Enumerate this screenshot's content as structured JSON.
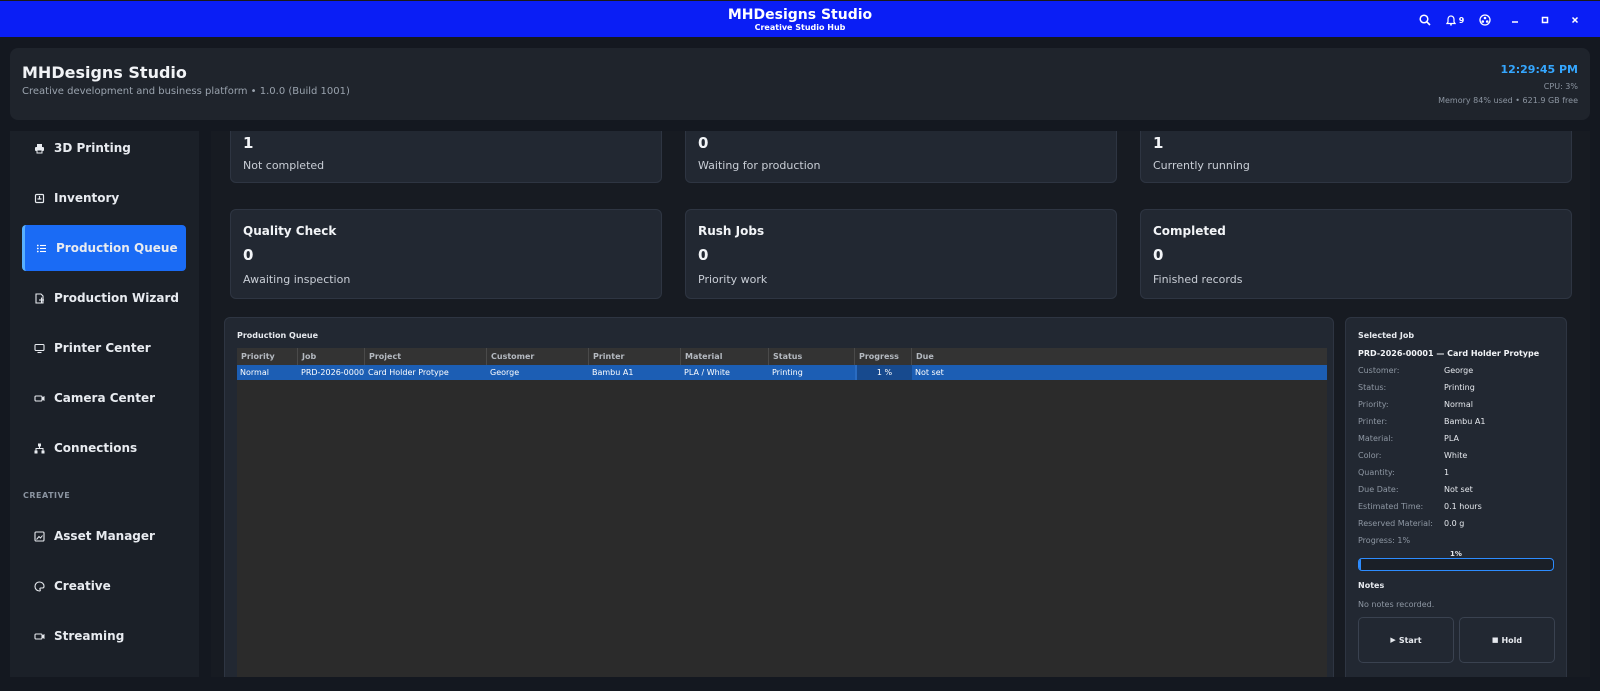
{
  "window": {
    "title": "MHDesigns Studio",
    "subtitle": "Creative Studio Hub",
    "notification_count": "9"
  },
  "header": {
    "title": "MHDesigns Studio",
    "subtitle": "Creative development and business platform • 1.0.0 (Build 1001)",
    "time": "12:29:45 PM",
    "cpu": "CPU: 3%",
    "memory": "Memory 84% used • 621.9 GB free"
  },
  "sidebar": {
    "items": [
      {
        "label": "3D Printing",
        "icon": "printer-icon"
      },
      {
        "label": "Inventory",
        "icon": "box-icon"
      },
      {
        "label": "Production Queue",
        "icon": "list-icon",
        "active": true
      },
      {
        "label": "Production Wizard",
        "icon": "wizard-icon"
      },
      {
        "label": "Printer Center",
        "icon": "monitor-icon"
      },
      {
        "label": "Camera Center",
        "icon": "camera-icon"
      },
      {
        "label": "Connections",
        "icon": "network-icon"
      }
    ],
    "section_creative": "CREATIVE",
    "creative_items": [
      {
        "label": "Asset Manager",
        "icon": "image-icon"
      },
      {
        "label": "Creative",
        "icon": "palette-icon"
      },
      {
        "label": "Streaming",
        "icon": "broadcast-icon"
      }
    ]
  },
  "stats": {
    "row1": [
      {
        "value": "1",
        "desc": "Not completed"
      },
      {
        "value": "0",
        "desc": "Waiting for production"
      },
      {
        "value": "1",
        "desc": "Currently running"
      }
    ],
    "row2": [
      {
        "title": "Quality Check",
        "value": "0",
        "desc": "Awaiting inspection"
      },
      {
        "title": "Rush Jobs",
        "value": "0",
        "desc": "Priority work"
      },
      {
        "title": "Completed",
        "value": "0",
        "desc": "Finished records"
      }
    ]
  },
  "queue": {
    "title": "Production Queue",
    "columns": [
      "Priority",
      "Job",
      "Project",
      "Customer",
      "Printer",
      "Material",
      "Status",
      "Progress",
      "Due"
    ],
    "rows": [
      {
        "priority": "Normal",
        "job": "PRD-2026-00001",
        "project": "Card Holder Protype",
        "customer": "George",
        "printer": "Bambu A1",
        "material": "PLA / White",
        "status": "Printing",
        "progress": "1 %",
        "due": "Not set"
      }
    ]
  },
  "selected_job": {
    "heading": "Selected Job",
    "title": "PRD-2026-00001 — Card Holder Protype",
    "fields": [
      {
        "key": "Customer:",
        "value": "George"
      },
      {
        "key": "Status:",
        "value": "Printing"
      },
      {
        "key": "Priority:",
        "value": "Normal"
      },
      {
        "key": "Printer:",
        "value": "Bambu A1"
      },
      {
        "key": "Material:",
        "value": "PLA"
      },
      {
        "key": "Color:",
        "value": "White"
      },
      {
        "key": "Quantity:",
        "value": "1"
      },
      {
        "key": "Due Date:",
        "value": "Not set"
      },
      {
        "key": "Estimated Time:",
        "value": "0.1 hours"
      },
      {
        "key": "Reserved Material:",
        "value": "0.0 g"
      }
    ],
    "progress_label": "Progress: 1%",
    "progress_pct_label": "1%",
    "progress_value": 0.01,
    "notes_heading": "Notes",
    "notes": "No notes recorded.",
    "start_label": "Start",
    "hold_label": "Hold"
  },
  "colors": {
    "titlebar": "#0a1ef5",
    "accent": "#1a6bf5",
    "time": "#35a7ff",
    "selected_row": "#1c5eb4"
  }
}
